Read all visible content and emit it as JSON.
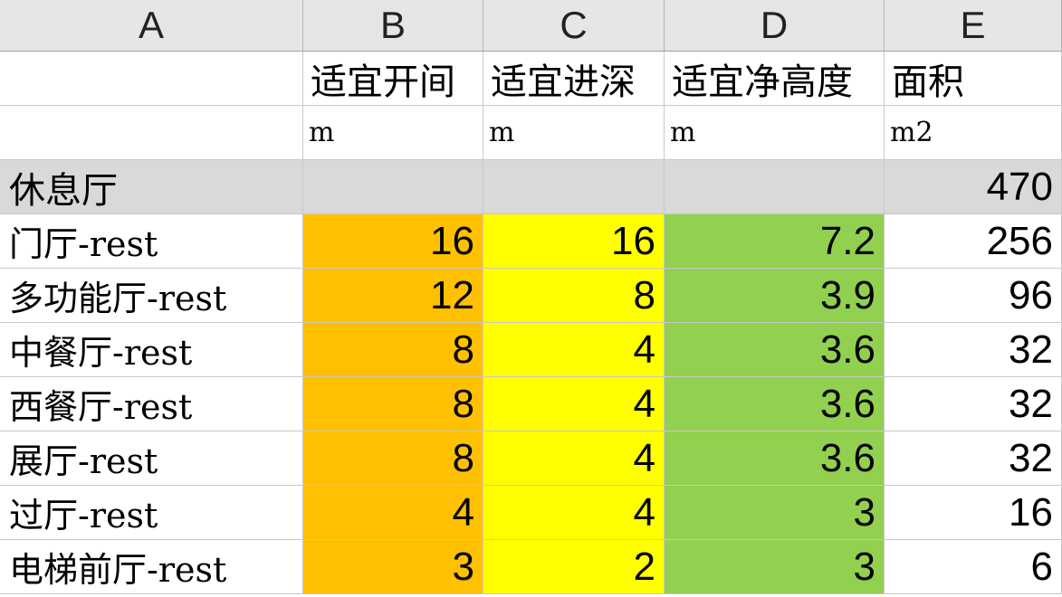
{
  "columns": [
    "A",
    "B",
    "C",
    "D",
    "E"
  ],
  "headers": {
    "A": "",
    "B": "适宜开间",
    "C": "适宜进深",
    "D": "适宜净高度",
    "E": "面积"
  },
  "units": {
    "A": "",
    "B": "m",
    "C": "m",
    "D": "m",
    "E": "m2"
  },
  "group": {
    "label": "休息厅",
    "area": "470"
  },
  "rows": [
    {
      "name": "门厅-rest",
      "width": "16",
      "depth": "16",
      "height": "7.2",
      "area": "256"
    },
    {
      "name": "多功能厅-rest",
      "width": "12",
      "depth": "8",
      "height": "3.9",
      "area": "96"
    },
    {
      "name": "中餐厅-rest",
      "width": "8",
      "depth": "4",
      "height": "3.6",
      "area": "32"
    },
    {
      "name": "西餐厅-rest",
      "width": "8",
      "depth": "4",
      "height": "3.6",
      "area": "32"
    },
    {
      "name": "展厅-rest",
      "width": "8",
      "depth": "4",
      "height": "3.6",
      "area": "32"
    },
    {
      "name": "过厅-rest",
      "width": "4",
      "depth": "4",
      "height": "3",
      "area": "16"
    },
    {
      "name": "电梯前厅-rest",
      "width": "3",
      "depth": "2",
      "height": "3",
      "area": "6"
    }
  ],
  "colors": {
    "width_fill": "#ffc000",
    "depth_fill": "#ffff00",
    "height_fill": "#92d050",
    "group_fill": "#d9d9d9",
    "column_header_fill": "#e6e6e6"
  }
}
